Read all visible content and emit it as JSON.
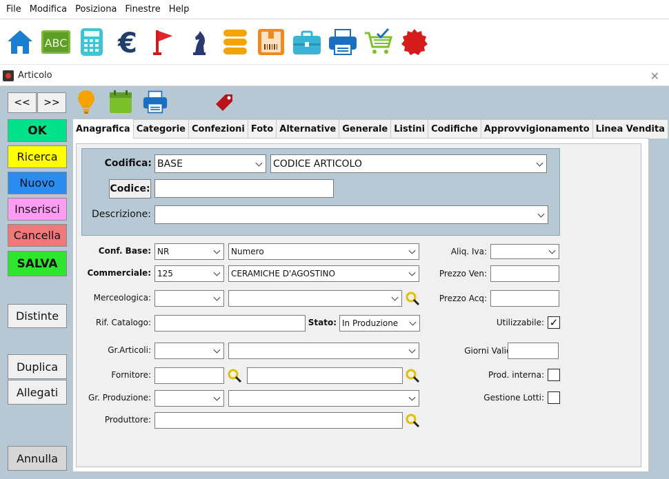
{
  "menu": [
    "File",
    "Modifica",
    "Posiziona",
    "Finestre",
    "Help"
  ],
  "window": {
    "title": "Articolo"
  },
  "nav": {
    "prev": "<<",
    "next": ">>"
  },
  "side_buttons": {
    "ok": "OK",
    "ricerca": "Ricerca",
    "nuovo": "Nuovo",
    "inserisci": "Inserisci",
    "cancella": "Cancella",
    "salva": "SALVA",
    "distinte": "Distinte",
    "duplica": "Duplica",
    "allegati": "Allegati",
    "annulla": "Annulla"
  },
  "tabs": [
    "Anagrafica",
    "Categorie",
    "Confezioni",
    "Foto",
    "Alternative",
    "Generale",
    "Listini",
    "Codifiche",
    "Approvvigionamento",
    "Linea Vendita"
  ],
  "form": {
    "codifica_label": "Codifica:",
    "codifica_value": "BASE",
    "codifica_type": "CODICE ARTICOLO",
    "codice_label": "Codice:",
    "codice_value": "",
    "descrizione_label": "Descrizione:",
    "descrizione_value": "",
    "conf_base_label": "Conf. Base:",
    "conf_base_code": "NR",
    "conf_base_desc": "Numero",
    "commerciale_label": "Commerciale:",
    "commerciale_code": "125",
    "commerciale_desc": "CERAMICHE D'AGOSTINO",
    "merceologica_label": "Merceologica:",
    "rif_catalogo_label": "Rif. Catalogo:",
    "stato_label": "Stato:",
    "stato_value": "In Produzione",
    "gr_articoli_label": "Gr.Articoli:",
    "fornitore_label": "Fornitore:",
    "gr_produzione_label": "Gr. Produzione:",
    "produttore_label": "Produttore:",
    "aliq_iva_label": "Aliq. Iva:",
    "prezzo_ven_label": "Prezzo Ven:",
    "prezzo_acq_label": "Prezzo Acq:",
    "utilizzabile_label": "Utilizzabile:",
    "utilizzabile_checked": "✓",
    "giorni_validita_label": "Giorni Validità:",
    "prod_interna_label": "Prod. interna:",
    "gestione_lotti_label": "Gestione Lotti:"
  },
  "colors": {
    "ok": "#00e28a",
    "ricerca": "#ffff00",
    "nuovo": "#2a8cf0",
    "inserisci": "#ff9cf4",
    "cancella": "#f07878",
    "salva": "#2ee62e"
  }
}
